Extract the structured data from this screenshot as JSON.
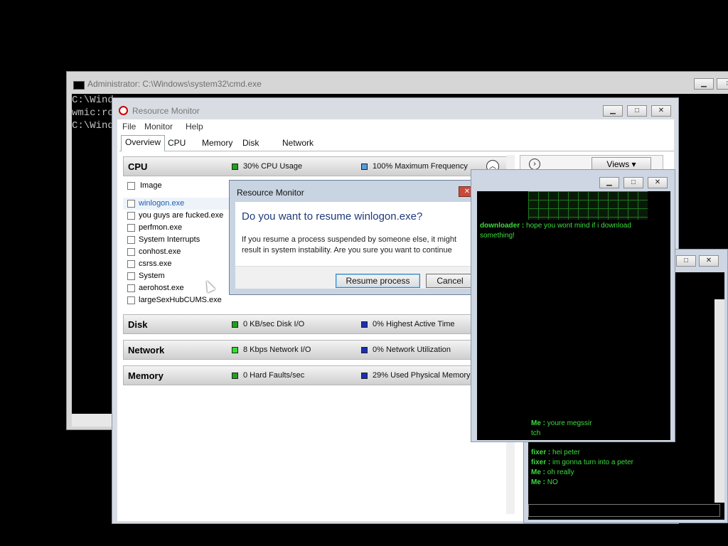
{
  "cmd": {
    "title": "Administrator: C:\\Windows\\system32\\cmd.exe",
    "lines": [
      "C:\\Wind",
      "wmic:ro",
      "",
      "C:\\Wind"
    ]
  },
  "resmon": {
    "title": "Resource Monitor",
    "menu": [
      "File",
      "Monitor",
      "Help"
    ],
    "tabs": [
      "Overview",
      "CPU",
      "Memory",
      "Disk",
      "Network"
    ],
    "active_tab": "Overview",
    "views_label": "Views",
    "cpu": {
      "name": "CPU",
      "usage": "30% CPU Usage",
      "freq": "100% Maximum Frequency",
      "usage_color": "#1fa01f",
      "freq_color": "#5b9bd5"
    },
    "image_header": "Image",
    "processes": [
      "winlogon.exe",
      "you guys are fucked.exe",
      "perfmon.exe",
      "System Interrupts",
      "conhost.exe",
      "csrss.exe",
      "System",
      "aerohost.exe",
      "largeSexHubCUMS.exe"
    ],
    "disk": {
      "name": "Disk",
      "io": "0 KB/sec Disk I/O",
      "active": "0% Highest Active Time",
      "io_color": "#1fa01f",
      "active_color": "#1a2fb0"
    },
    "network": {
      "name": "Network",
      "io": "8 Kbps Network I/O",
      "util": "0% Network Utilization",
      "io_color": "#2fe02f",
      "util_color": "#1a2fb0"
    },
    "memory": {
      "name": "Memory",
      "faults": "0 Hard Faults/sec",
      "used": "29% Used Physical Memory",
      "faults_color": "#1fa01f",
      "used_color": "#1a2fb0"
    }
  },
  "dialog": {
    "title": "Resource Monitor",
    "question": "Do you want to resume winlogon.exe?",
    "message_line1": "If you resume a process suspended by someone else, it might",
    "message_line2": "result in system instability. Are you sure you want to continue",
    "resume_label": "Resume process",
    "cancel_label": "Cancel"
  },
  "chat": {
    "messages": [
      {
        "user": "downloader :",
        "text": " hope you wont mind if i download"
      },
      {
        "user": "",
        "text": "something!"
      }
    ],
    "lines_bottom": [
      {
        "user": "Me :",
        "text": " youre megssir"
      },
      {
        "user": "",
        "text": "tch"
      }
    ]
  },
  "chat2": {
    "messages": [
      {
        "user": "fixer :",
        "text": " hei peter"
      },
      {
        "user": "fixer :",
        "text": " im gonna turn into a peter"
      },
      {
        "user": "Me :",
        "text": " oh really"
      },
      {
        "user": "Me :",
        "text": " NO"
      }
    ]
  }
}
